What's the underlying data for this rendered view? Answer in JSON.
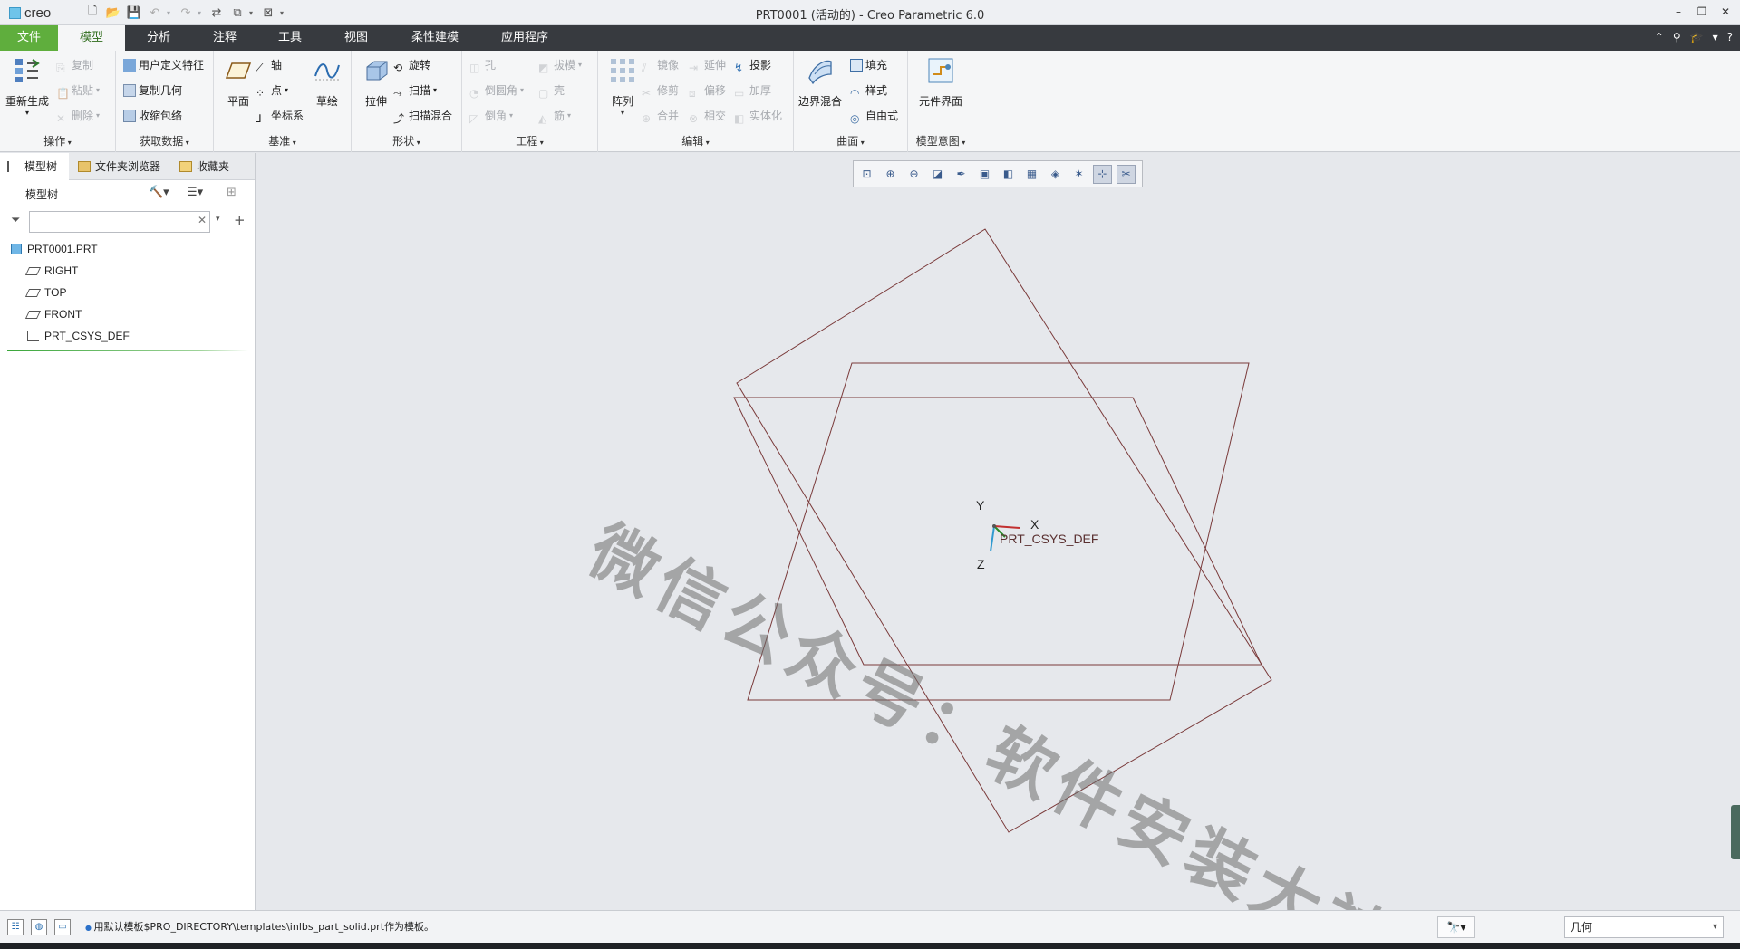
{
  "app": {
    "brand": "creo",
    "window_title": "PRT0001 (活动的) - Creo Parametric 6.0",
    "window_controls": [
      "–",
      "❐",
      "✕"
    ]
  },
  "tabs": {
    "file": "文件",
    "model": "模型",
    "analysis": "分析",
    "annotate": "注释",
    "tools": "工具",
    "view": "视图",
    "flexible": "柔性建模",
    "applications": "应用程序"
  },
  "ribbon": {
    "operations": {
      "label": "操作",
      "regenerate": "重新生成",
      "copy": "复制",
      "paste": "粘贴",
      "delete": "删除"
    },
    "get_data": {
      "label": "获取数据",
      "udf": "用户定义特征",
      "copy_geom": "复制几何",
      "shrinkwrap": "收缩包络"
    },
    "datum": {
      "label": "基准",
      "plane": "平面",
      "axis": "轴",
      "point": "点",
      "csys": "坐标系",
      "sketch": "草绘"
    },
    "shapes": {
      "label": "形状",
      "extrude": "拉伸",
      "revolve": "旋转",
      "sweep": "扫描",
      "swept_blend": "扫描混合"
    },
    "engineering": {
      "label": "工程",
      "hole": "孔",
      "draft": "拔模",
      "round": "倒圆角",
      "shell": "壳",
      "chamfer": "倒角",
      "rib": "筋"
    },
    "editing": {
      "label": "编辑",
      "pattern": "阵列",
      "mirror": "镜像",
      "extend": "延伸",
      "project": "投影",
      "trim": "修剪",
      "offset": "偏移",
      "thicken": "加厚",
      "merge": "合并",
      "intersect": "相交",
      "solidify": "实体化"
    },
    "surfaces": {
      "label": "曲面",
      "boundary_blend": "边界混合",
      "fill": "填充",
      "style": "样式",
      "freestyle": "自由式"
    },
    "model_intent": {
      "label": "模型意图",
      "component_interface": "元件界面"
    }
  },
  "left_panel": {
    "nav_tabs": [
      "模型树",
      "文件夹浏览器",
      "收藏夹"
    ],
    "tree_title": "模型树",
    "search_placeholder": "",
    "tree_items": [
      "PRT0001.PRT",
      "RIGHT",
      "TOP",
      "FRONT",
      "PRT_CSYS_DEF"
    ]
  },
  "graphics": {
    "csys_label": "PRT_CSYS_DEF",
    "axis_x": "X",
    "axis_y": "Y",
    "axis_z": "Z",
    "watermark": "微信公众号：软件安装大神",
    "plane_color": "#7a3a3a"
  },
  "status": {
    "message": "用默认模板$PRO_DIRECTORY\\templates\\inlbs_part_solid.prt作为模板。",
    "filter_value": "几何"
  },
  "colors": {
    "file_tab": "#5fae3d",
    "tabbar": "#373a3f",
    "model_tab_text": "#2f6c1c"
  }
}
